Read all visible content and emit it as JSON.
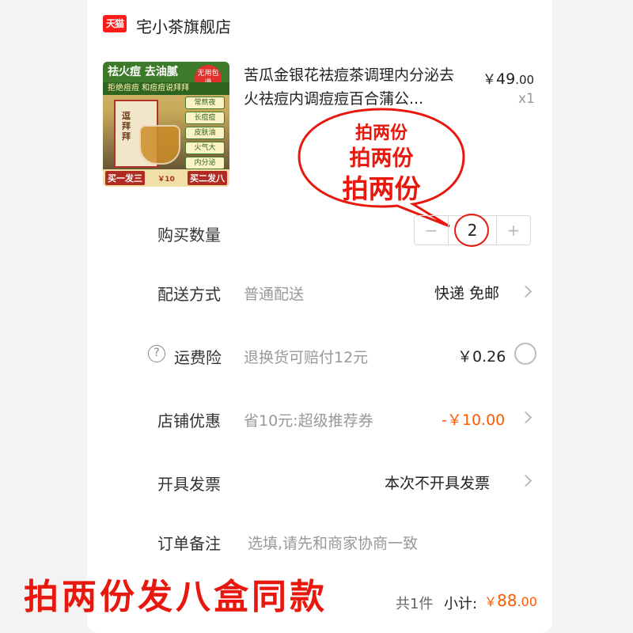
{
  "store": {
    "logo_text": "天猫",
    "name": "宅小茶旗舰店"
  },
  "product": {
    "title": "苦瓜金银花祛痘茶调理内分泌去火祛痘内调痘痘百合蒲公...",
    "price_symbol": "￥",
    "price_int": "49",
    "price_cents": ".00",
    "qty_label": "x1",
    "image": {
      "headline": "祛火痘 去油腻",
      "badge": "无用包退",
      "subline": "拒绝痘痘 和痘痘说拜拜",
      "box_text": "逗拜拜",
      "tags": [
        "常熬夜",
        "长痘痘",
        "皮肤油",
        "火气大",
        "内分泌"
      ],
      "bottom_left": "买一发三",
      "bottom_mid": "￥10",
      "bottom_right": "买二发八"
    }
  },
  "bubble": {
    "line1": "拍两份",
    "line2": "拍两份",
    "line3": "拍两份"
  },
  "quantity": {
    "label": "购买数量",
    "minus": "−",
    "value": "2",
    "plus": "+"
  },
  "delivery": {
    "label": "配送方式",
    "value": "普通配送",
    "right": "快递 免邮"
  },
  "insurance": {
    "help": "?",
    "label": "运费险",
    "value": "退换货可赔付12元",
    "right": "￥0.26"
  },
  "coupon": {
    "label": "店铺优惠",
    "value": "省10元:超级推荐券",
    "right": "-￥10.00"
  },
  "invoice": {
    "label": "开具发票",
    "right": "本次不开具发票"
  },
  "note": {
    "label": "订单备注",
    "placeholder": "选填,请先和商家协商一致"
  },
  "promo_text": "拍两份发八盒同款",
  "total": {
    "count": "共1件",
    "label": "小计:",
    "symbol": "￥",
    "int": "88",
    "cents": ".00"
  },
  "colors": {
    "accent": "#ff5a00",
    "promo_red": "#e8180e",
    "tmall_red": "#ff1a1a"
  }
}
